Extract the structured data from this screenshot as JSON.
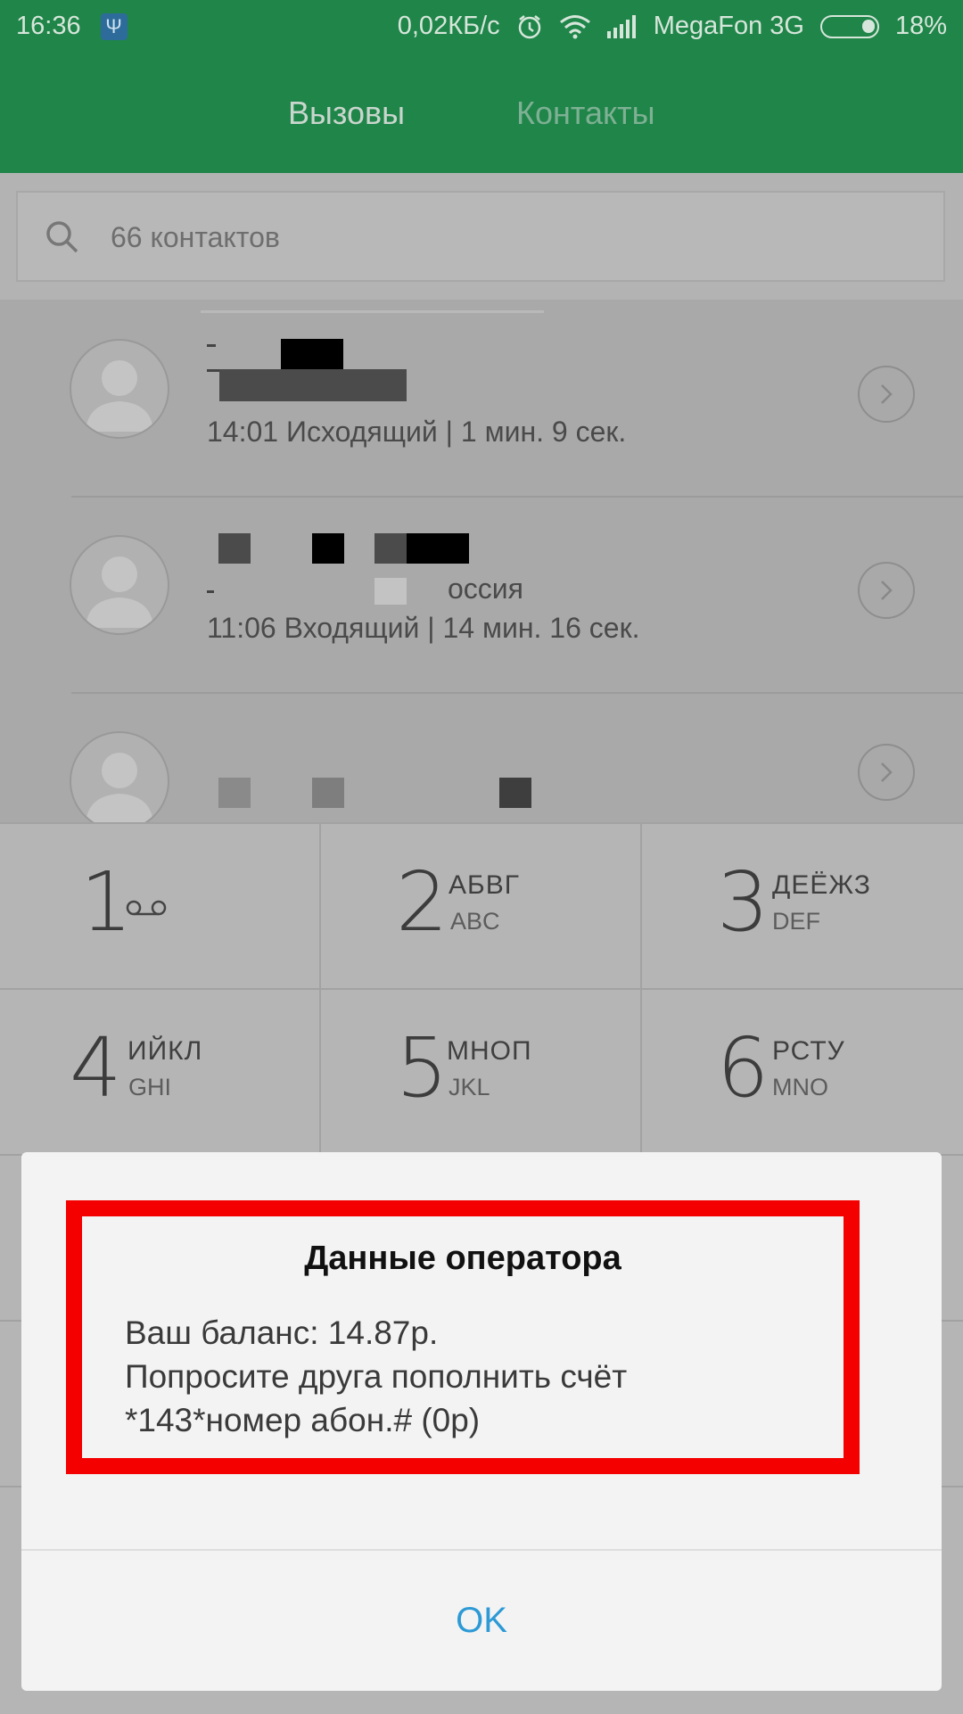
{
  "status_bar": {
    "time": "16:36",
    "speed": "0,02КБ/с",
    "carrier": "MegaFon 3G",
    "battery": "18%",
    "icons": [
      "usb-icon",
      "alarm-icon",
      "wifi-icon",
      "signal-icon",
      "battery-icon"
    ]
  },
  "tabs": [
    {
      "label": "Вызовы",
      "active": true
    },
    {
      "label": "Контакты",
      "active": false
    }
  ],
  "search": {
    "placeholder": "66 контактов"
  },
  "calls": [
    {
      "detail": "14:01 Исходящий | 1 мин. 9 сек."
    },
    {
      "partial_location": "оссия",
      "detail": "11:06 Входящий | 14 мин. 16 сек."
    },
    {
      "detail": ""
    }
  ],
  "dialpad": [
    {
      "digit": "1",
      "l1": "",
      "l2": ""
    },
    {
      "digit": "2",
      "l1": "АБВГ",
      "l2": "ABC"
    },
    {
      "digit": "3",
      "l1": "ДЕЁЖЗ",
      "l2": "DEF"
    },
    {
      "digit": "4",
      "l1": "ИЙКЛ",
      "l2": "GHI"
    },
    {
      "digit": "5",
      "l1": "МНОП",
      "l2": "JKL"
    },
    {
      "digit": "6",
      "l1": "РСТУ",
      "l2": "MNO"
    }
  ],
  "dialog": {
    "title": "Данные оператора",
    "lines": [
      "Ваш баланс: 14.87р.",
      "Попросите друга пополнить счёт",
      "*143*номер абон.# (0р)"
    ],
    "ok_label": "OK"
  },
  "colors": {
    "header_green": "#1f8549",
    "highlight_red": "#f40000",
    "button_blue": "#2d9ad6"
  }
}
